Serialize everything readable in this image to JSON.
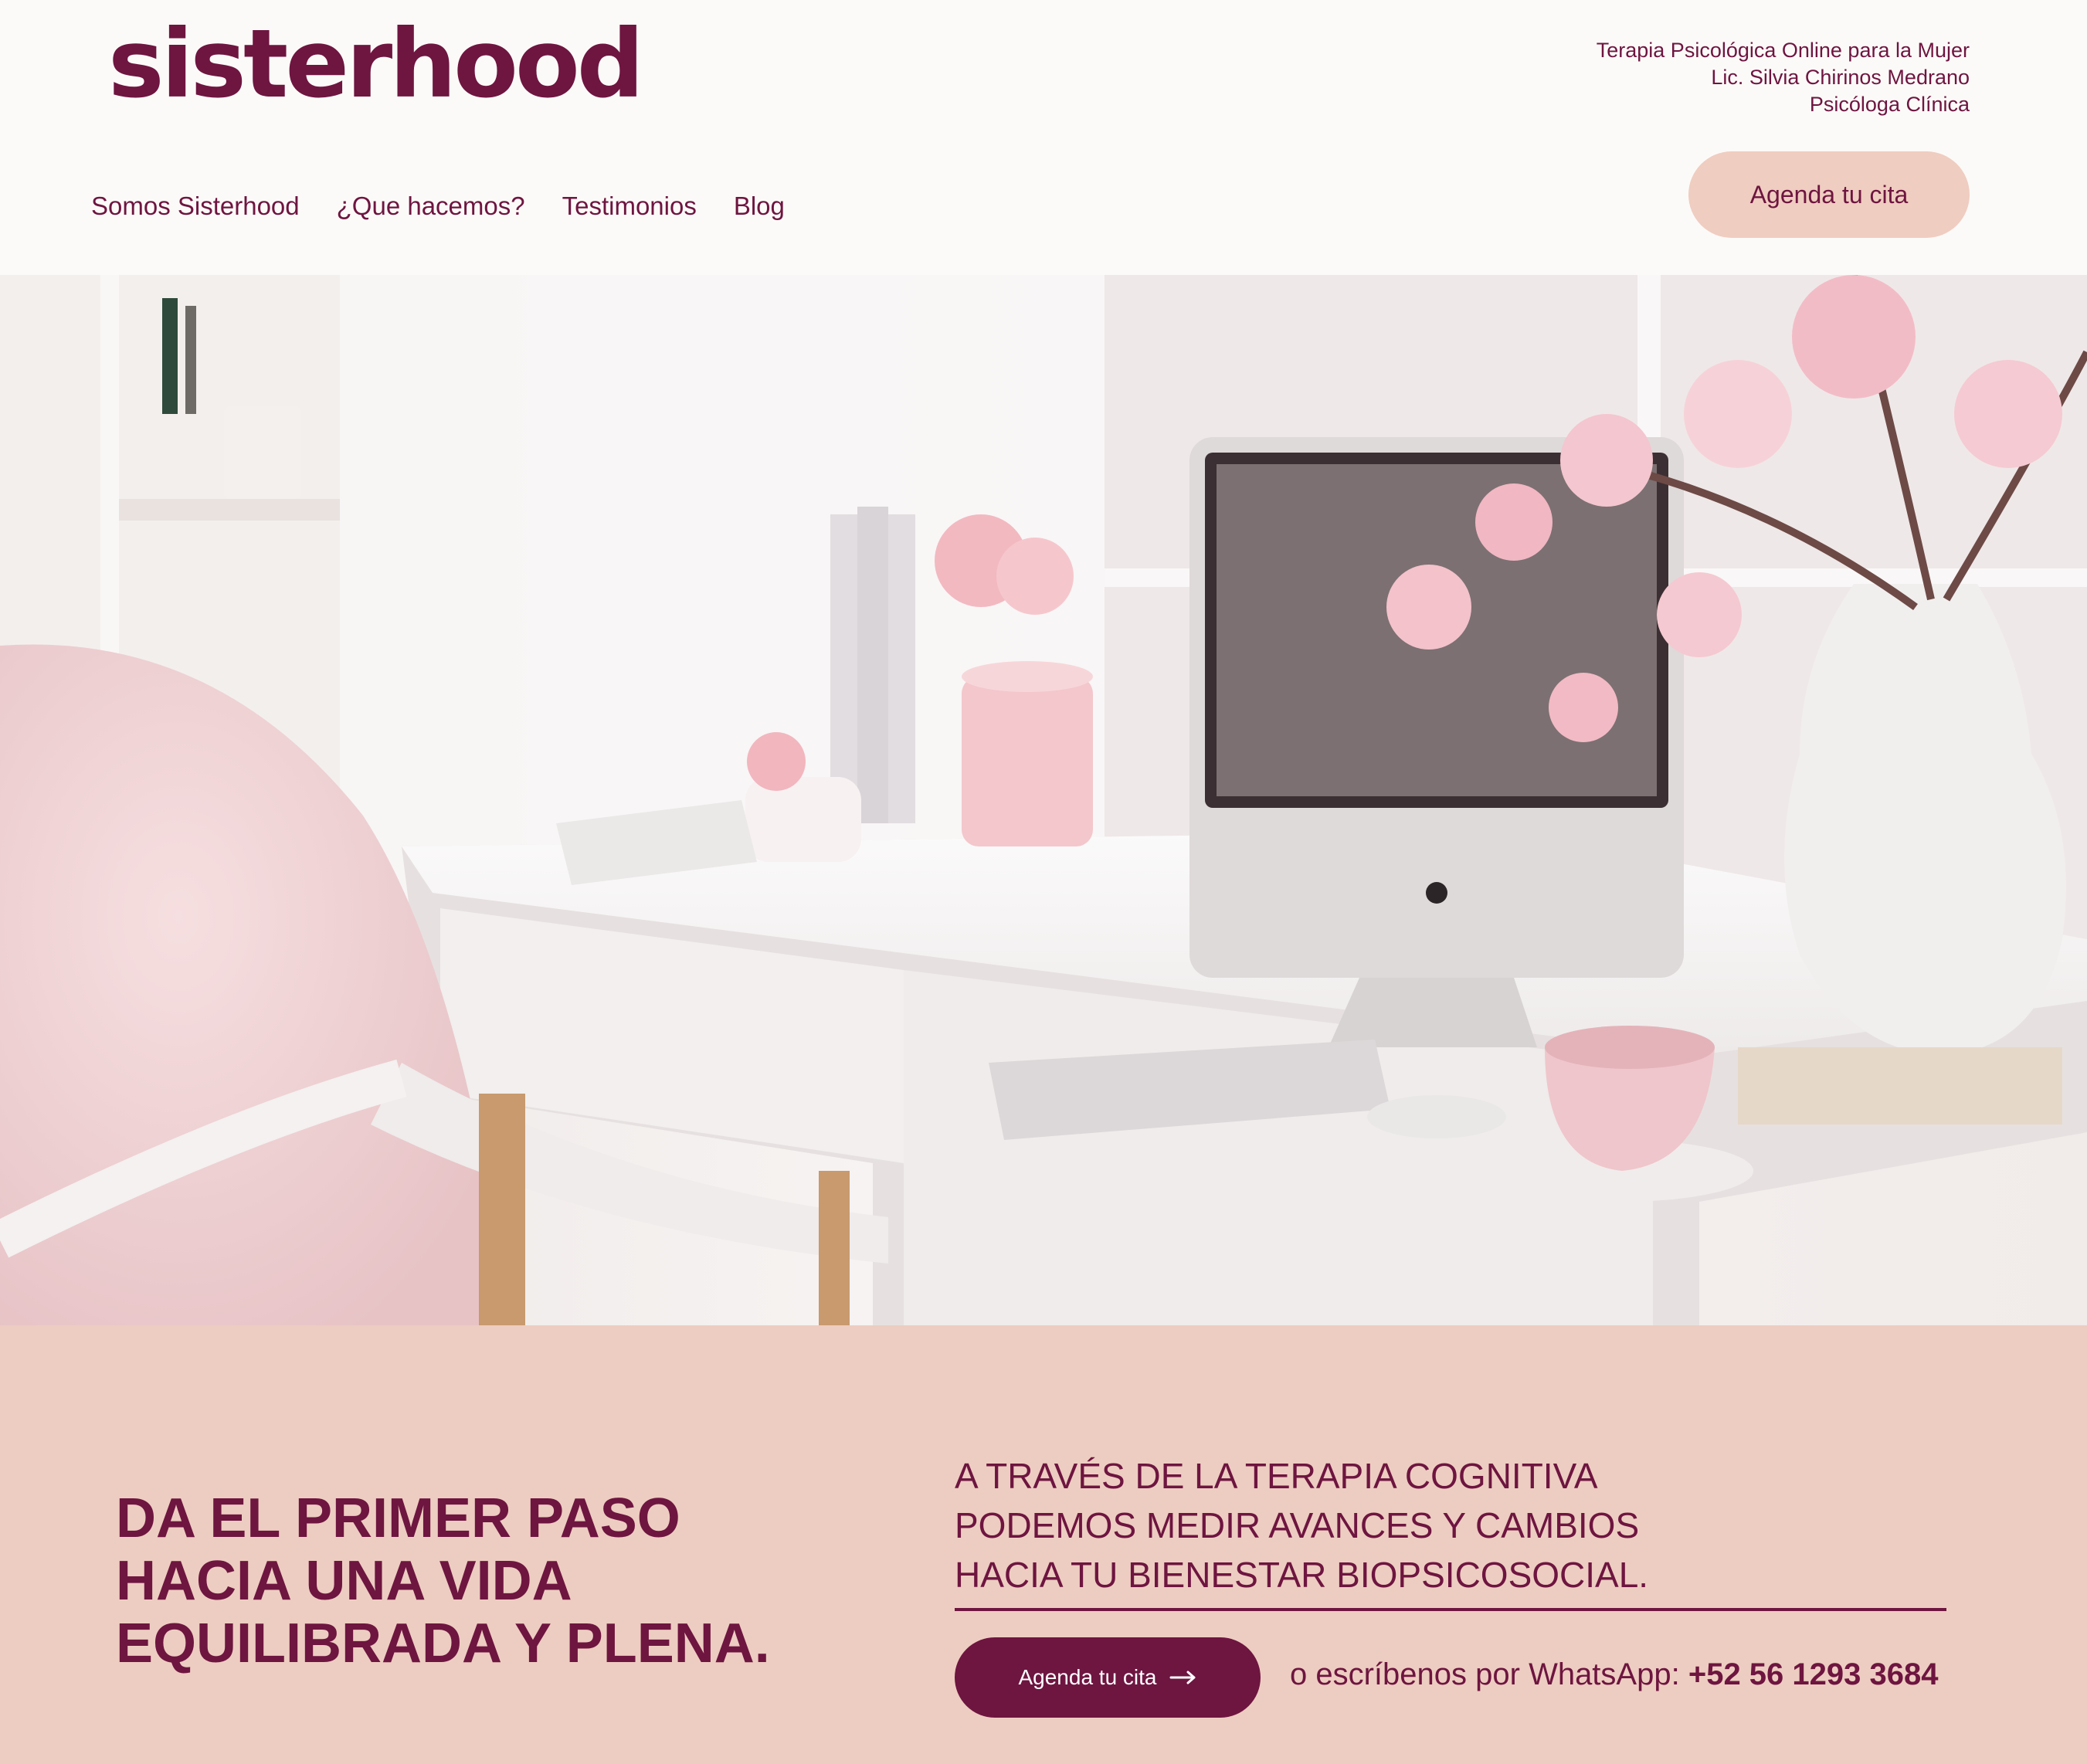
{
  "brand": {
    "logo_text": "sisterhood"
  },
  "header": {
    "tagline": [
      "Terapia Psicológica Online para la Mujer",
      "Lic. Silvia Chirinos Medrano",
      "Psicóloga Clínica"
    ],
    "cta_label": "Agenda tu cita"
  },
  "nav": {
    "items": [
      {
        "label": "Somos Sisterhood"
      },
      {
        "label": "¿Que hacemos?"
      },
      {
        "label": "Testimonios"
      },
      {
        "label": "Blog"
      }
    ]
  },
  "hero": {
    "image_icon": "desk-workspace-photo"
  },
  "main": {
    "headline": [
      "DA EL PRIMER PASO",
      "HACIA UNA VIDA",
      "EQUILIBRADA Y PLENA."
    ],
    "description": [
      "A TRAVÉS DE LA TERAPIA COGNITIVA",
      "PODEMOS MEDIR AVANCES Y CAMBIOS",
      "HACIA TU BIENESTAR BIOPSICOSOCIAL."
    ],
    "cta_label": "Agenda tu cita",
    "cta_icon": "arrow-right-icon",
    "whatsapp_text": "o escríbenos por WhatsApp:",
    "whatsapp_phone": "+52 56 1293 3684"
  },
  "colors": {
    "brand": "#6e1540",
    "header_bg": "#fcfaf8",
    "soft_pink": "#efcdc0",
    "section_bg": "#edcdc1"
  }
}
